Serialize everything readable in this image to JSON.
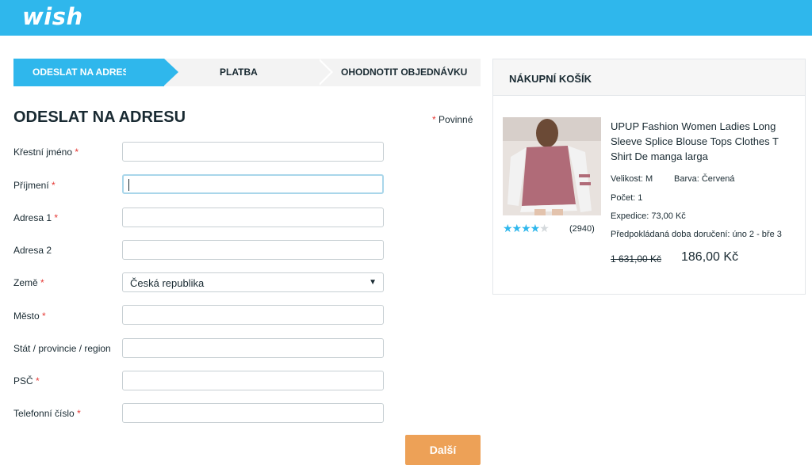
{
  "header": {
    "logo": "wish"
  },
  "steps": [
    {
      "label": "ODESLAT NA ADRESU",
      "active": true
    },
    {
      "label": "PLATBA",
      "active": false
    },
    {
      "label": "OHODNOTIT OBJEDNÁVKU",
      "active": false
    }
  ],
  "form": {
    "title": "ODESLAT NA ADRESU",
    "required_note": "Povinné",
    "fields": [
      {
        "label": "Křestní jméno",
        "required": true,
        "value": ""
      },
      {
        "label": "Příjmení",
        "required": true,
        "value": ""
      },
      {
        "label": "Adresa 1",
        "required": true,
        "value": ""
      },
      {
        "label": "Adresa 2",
        "required": false,
        "value": ""
      },
      {
        "label": "Země",
        "required": true,
        "value": "Česká republika"
      },
      {
        "label": "Město",
        "required": true,
        "value": ""
      },
      {
        "label": "Stát / provincie / region",
        "required": false,
        "value": ""
      },
      {
        "label": "PSČ",
        "required": true,
        "value": ""
      },
      {
        "label": "Telefonní číslo",
        "required": true,
        "value": ""
      }
    ],
    "next_label": "Další"
  },
  "cart": {
    "title": "NÁKUPNÍ KOŠÍK",
    "product": {
      "name": "UPUP Fashion Women Ladies Long Sleeve Splice Blouse Tops Clothes T Shirt De manga larga",
      "size": "Velikost: M",
      "color": "Barva: Červená",
      "quantity": "Počet:  1",
      "shipping": "Expedice: 73,00 Kč",
      "delivery": "Předpokládaná doba doručení: úno 2 - bře 3",
      "old_price": "1 631,00 Kč",
      "price": "186,00 Kč",
      "rating_count": "(2940)",
      "rating_stars": 4
    }
  },
  "colors": {
    "brand": "#2fb7ec",
    "button": "#eda157",
    "required": "#e53935"
  }
}
